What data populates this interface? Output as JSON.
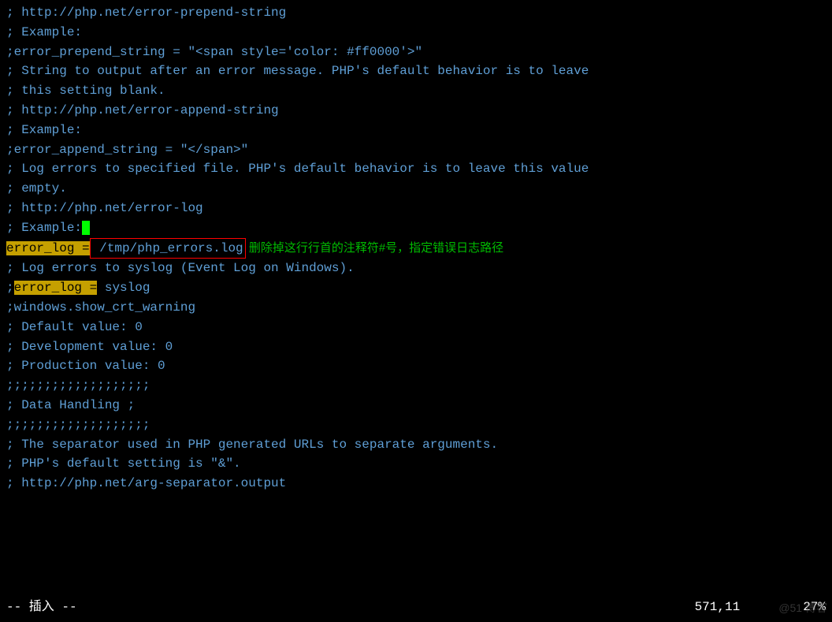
{
  "lines": {
    "l1": "; http://php.net/error-prepend-string",
    "l2": "; Example:",
    "l3": ";error_prepend_string = \"<span style='color: #ff0000'>\"",
    "l4": "",
    "l5": "; String to output after an error message. PHP's default behavior is to leave",
    "l6": "; this setting blank.",
    "l7": "; http://php.net/error-append-string",
    "l8": "; Example:",
    "l9": ";error_append_string = \"</span>\"",
    "l10": "",
    "l11": "; Log errors to specified file. PHP's default behavior is to leave this value",
    "l12": "; empty.",
    "l13": "; http://php.net/error-log",
    "l14": "; Example:",
    "l15_a": "error_log =",
    "l15_b": " /tmp/php_errors.log",
    "l15_annotation": " 删除掉这行行首的注释符#号，指定错误日志路径",
    "l16": "; Log errors to syslog (Event Log on Windows).",
    "l17_a": ";",
    "l17_b": "error_log =",
    "l17_c": " syslog",
    "l18": "",
    "l19": ";windows.show_crt_warning",
    "l20": "; Default value: 0",
    "l21": "; Development value: 0",
    "l22": "; Production value: 0",
    "l23": "",
    "l24": ";;;;;;;;;;;;;;;;;;;",
    "l25": "; Data Handling ;",
    "l26": ";;;;;;;;;;;;;;;;;;;",
    "l27": "",
    "l28": "; The separator used in PHP generated URLs to separate arguments.",
    "l29": "; PHP's default setting is \"&\".",
    "l30": "; http://php.net/arg-separator.output"
  },
  "status": {
    "mode": "-- 插入 --",
    "position": "571,11",
    "percent": "27%"
  },
  "watermark": "@51  博客"
}
